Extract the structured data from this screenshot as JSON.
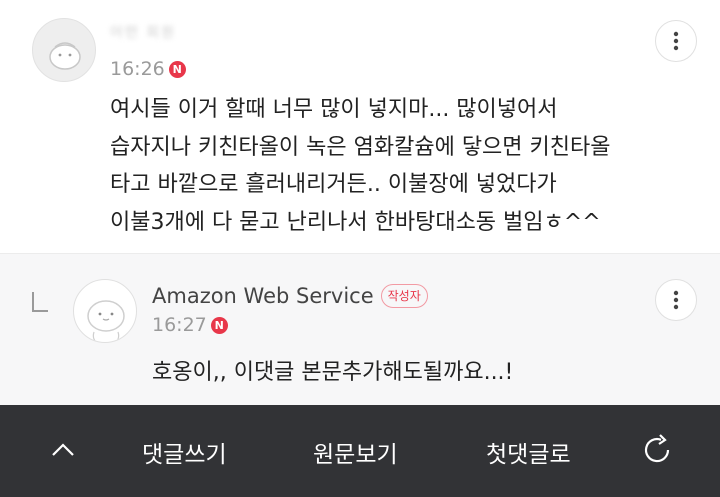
{
  "comments": [
    {
      "author": "어떤 회원",
      "time": "16:26",
      "badge": "N",
      "body_lines": [
        "여시들 이거 할때 너무 많이 넣지마... 많이넣어서",
        "습자지나 키친타올이 녹은 염화칼슘에 닿으면 키친타올",
        "타고 바깥으로 흘러내리거든.. 이불장에 넣었다가",
        "이불3개에 다 묻고 난리나서 한바탕대소동 벌임ㅎ^^"
      ],
      "more_icon": "kebab-menu-icon"
    }
  ],
  "reply": {
    "author": "Amazon Web Service",
    "writer_badge": "작성자",
    "time": "16:27",
    "badge": "N",
    "body": "호옹이,, 이댓글 본문추가해도될까요...!",
    "more_icon": "kebab-menu-icon"
  },
  "toolbar": {
    "up_icon": "chevron-up-icon",
    "write_comment": "댓글쓰기",
    "view_original": "원문보기",
    "first_comment": "첫댓글로",
    "refresh_icon": "refresh-icon"
  },
  "colors": {
    "toolbar_bg": "#323336",
    "new_badge": "#e8374a",
    "reply_bg": "#f7f7f8"
  }
}
